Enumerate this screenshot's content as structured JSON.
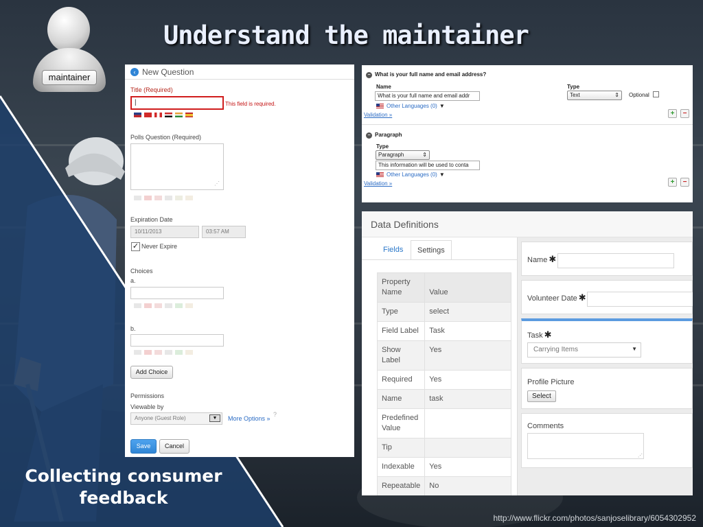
{
  "slide": {
    "title": "Understand the maintainer",
    "avatar_label": "maintainer",
    "caption_line1": "Collecting consumer",
    "caption_line2": "feedback",
    "credit": "http://www.flickr.com/photos/sanjoselibrary/6054302952"
  },
  "new_question": {
    "header": "New Question",
    "title_label": "Title (Required)",
    "title_value": "|",
    "title_error": "This field is required.",
    "poll_label": "Polls Question (Required)",
    "expiration_label": "Expiration Date",
    "expiration_date": "10/11/2013",
    "expiration_time": "03:57 AM",
    "never_expire_label": "Never Expire",
    "never_expire_mark": "✓",
    "choices_label": "Choices",
    "choice_a": "a.",
    "choice_b": "b.",
    "add_choice": "Add Choice",
    "permissions_label": "Permissions",
    "viewable_label": "Viewable by",
    "viewable_value": "Anyone (Guest Role)",
    "more_options": "More Options »",
    "save": "Save",
    "cancel": "Cancel"
  },
  "question_fields": {
    "q1_title": "What is your full name and email address?",
    "name_label": "Name",
    "name_value": "What is your full name and email addr",
    "type_label": "Type",
    "type_value": "Text",
    "optional_label": "Optional",
    "other_languages": "Other Languages (0)",
    "validation": "Validation »",
    "q2_title": "Paragraph",
    "q2_type_label": "Type",
    "q2_type_value": "Paragraph",
    "q2_text": "This information will be used to conta",
    "q2_other_languages": "Other Languages (0)",
    "q2_validation": "Validation »",
    "plus": "+",
    "minus": "−"
  },
  "data_definitions": {
    "title": "Data Definitions",
    "tab_fields": "Fields",
    "tab_settings": "Settings",
    "col_property": "Property Name",
    "col_value": "Value",
    "rows": [
      {
        "k": "Type",
        "v": "select"
      },
      {
        "k": "Field Label",
        "v": "Task"
      },
      {
        "k": "Show Label",
        "v": "Yes"
      },
      {
        "k": "Required",
        "v": "Yes"
      },
      {
        "k": "Name",
        "v": "task"
      },
      {
        "k": "Predefined Value",
        "v": ""
      },
      {
        "k": "Tip",
        "v": ""
      },
      {
        "k": "Indexable",
        "v": "Yes"
      },
      {
        "k": "Repeatable",
        "v": "No"
      }
    ],
    "name_label": "Name",
    "volunteer_label": "Volunteer Date",
    "task_label": "Task",
    "task_value": "Carrying Items",
    "profile_label": "Profile Picture",
    "select_btn": "Select",
    "comments_label": "Comments",
    "required_mark": "✱"
  },
  "colors": {
    "accent_blue": "#2f86d6",
    "error_red": "#d01c1c",
    "wedge": "#1d3f6b"
  }
}
